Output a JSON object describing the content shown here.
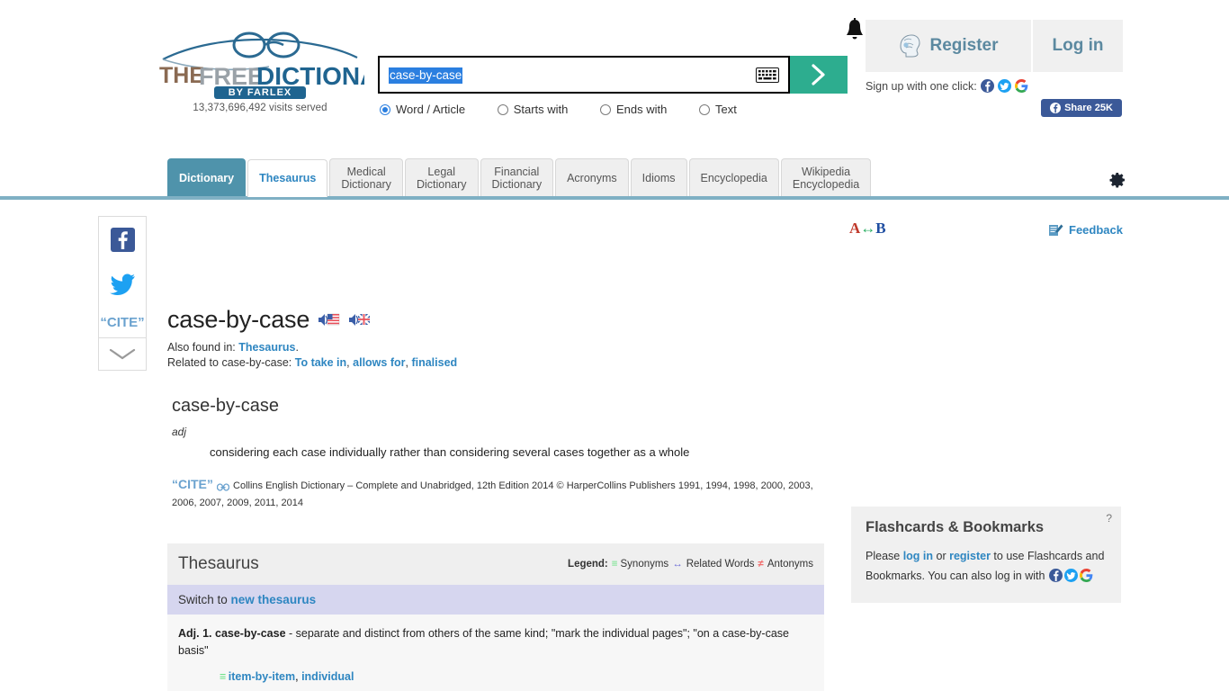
{
  "site": {
    "logo_the": "THE",
    "logo_free": "FREE",
    "logo_dictionary": "DICTIONARY",
    "logo_byline": "BY FARLEX",
    "visits": "13,373,696,492 visits served"
  },
  "search": {
    "value": "case-by-case",
    "placeholder": "",
    "keyboard_icon": "keyboard-icon",
    "go_icon": "chevron-right-icon",
    "options": [
      {
        "label": "Word / Article",
        "checked": true
      },
      {
        "label": "Starts with",
        "checked": false
      },
      {
        "label": "Ends with",
        "checked": false
      },
      {
        "label": "Text",
        "checked": false
      }
    ]
  },
  "account": {
    "bell_icon": "notification-bell-icon",
    "register_label": "Register",
    "register_icon": "brain-head-icon",
    "login_label": "Log in",
    "signup_text": "Sign up with one click:",
    "signup_providers": [
      "facebook",
      "twitter",
      "google"
    ],
    "share_label": "Share 25K",
    "share_icon": "facebook-icon"
  },
  "nav": {
    "tabs": [
      {
        "label": "Dictionary",
        "state": "active"
      },
      {
        "label": "Thesaurus",
        "state": "current"
      },
      {
        "label": "Medical\nDictionary",
        "state": "normal"
      },
      {
        "label": "Legal\nDictionary",
        "state": "normal"
      },
      {
        "label": "Financial\nDictionary",
        "state": "normal"
      },
      {
        "label": "Acronyms",
        "state": "normal"
      },
      {
        "label": "Idioms",
        "state": "normal"
      },
      {
        "label": "Encyclopedia",
        "state": "normal"
      },
      {
        "label": "Wikipedia\nEncyclopedia",
        "state": "normal"
      }
    ],
    "settings_icon": "gear-icon"
  },
  "rail": {
    "facebook_icon": "facebook-icon",
    "twitter_icon": "twitter-icon",
    "cite_label": "“CITE”",
    "more_icon": "chevron-down-icon"
  },
  "utility": {
    "translate_a": "A",
    "translate_arrow": "↔",
    "translate_b": "B",
    "feedback_label": "Feedback",
    "feedback_icon": "feedback-pencil-icon"
  },
  "article": {
    "headword": "case-by-case",
    "audio_us_icon": "speaker-us-flag-icon",
    "audio_uk_icon": "speaker-uk-flag-icon",
    "also_found_prefix": "Also found in:",
    "also_found_link": "Thesaurus",
    "related_prefix": "Related to case-by-case:",
    "related_links": [
      "To take in",
      "allows for",
      "finalised"
    ]
  },
  "definition": {
    "word": "case-by-case",
    "part_of_speech": "adj",
    "text": "considering each case individually rather than considering several cases together as a whole",
    "cite_label": "“CITE”",
    "cite_link_icon": "link-icon",
    "source": "Collins English Dictionary – Complete and Unabridged, 12th Edition 2014 © HarperCollins Publishers 1991, 1994, 1998, 2000, 2003, 2006, 2007, 2009, 2011, 2014"
  },
  "thesaurus": {
    "title": "Thesaurus",
    "legend_label": "Legend:",
    "legend_synonyms": "Synonyms",
    "legend_related": "Related Words",
    "legend_antonyms": "Antonyms",
    "switch_prefix": "Switch to",
    "switch_link": "new thesaurus",
    "entry_num": "Adj. 1.",
    "entry_word": "case-by-case",
    "entry_def": "- separate and distinct from others of the same kind; \"mark the individual pages\"; \"on a case-by-case basis\"",
    "synonyms": [
      "item-by-item",
      "individual"
    ]
  },
  "flashcards": {
    "title": "Flashcards & Bookmarks",
    "help": "?",
    "text_1": "Please ",
    "login_link": "log in",
    "text_2": " or ",
    "register_link": "register",
    "text_3": " to use Flashcards and Bookmarks. You can also log in with ",
    "providers": [
      "facebook",
      "twitter",
      "google"
    ]
  },
  "colors": {
    "accent_teal": "#4f93ab",
    "go_green": "#2dad8f",
    "link_blue": "#2e86c1",
    "selection_blue": "#2b7fe0",
    "switch_lavender": "#d6d6ef",
    "syn_green": "#5ee07a",
    "ant_red": "#f26d6d"
  }
}
